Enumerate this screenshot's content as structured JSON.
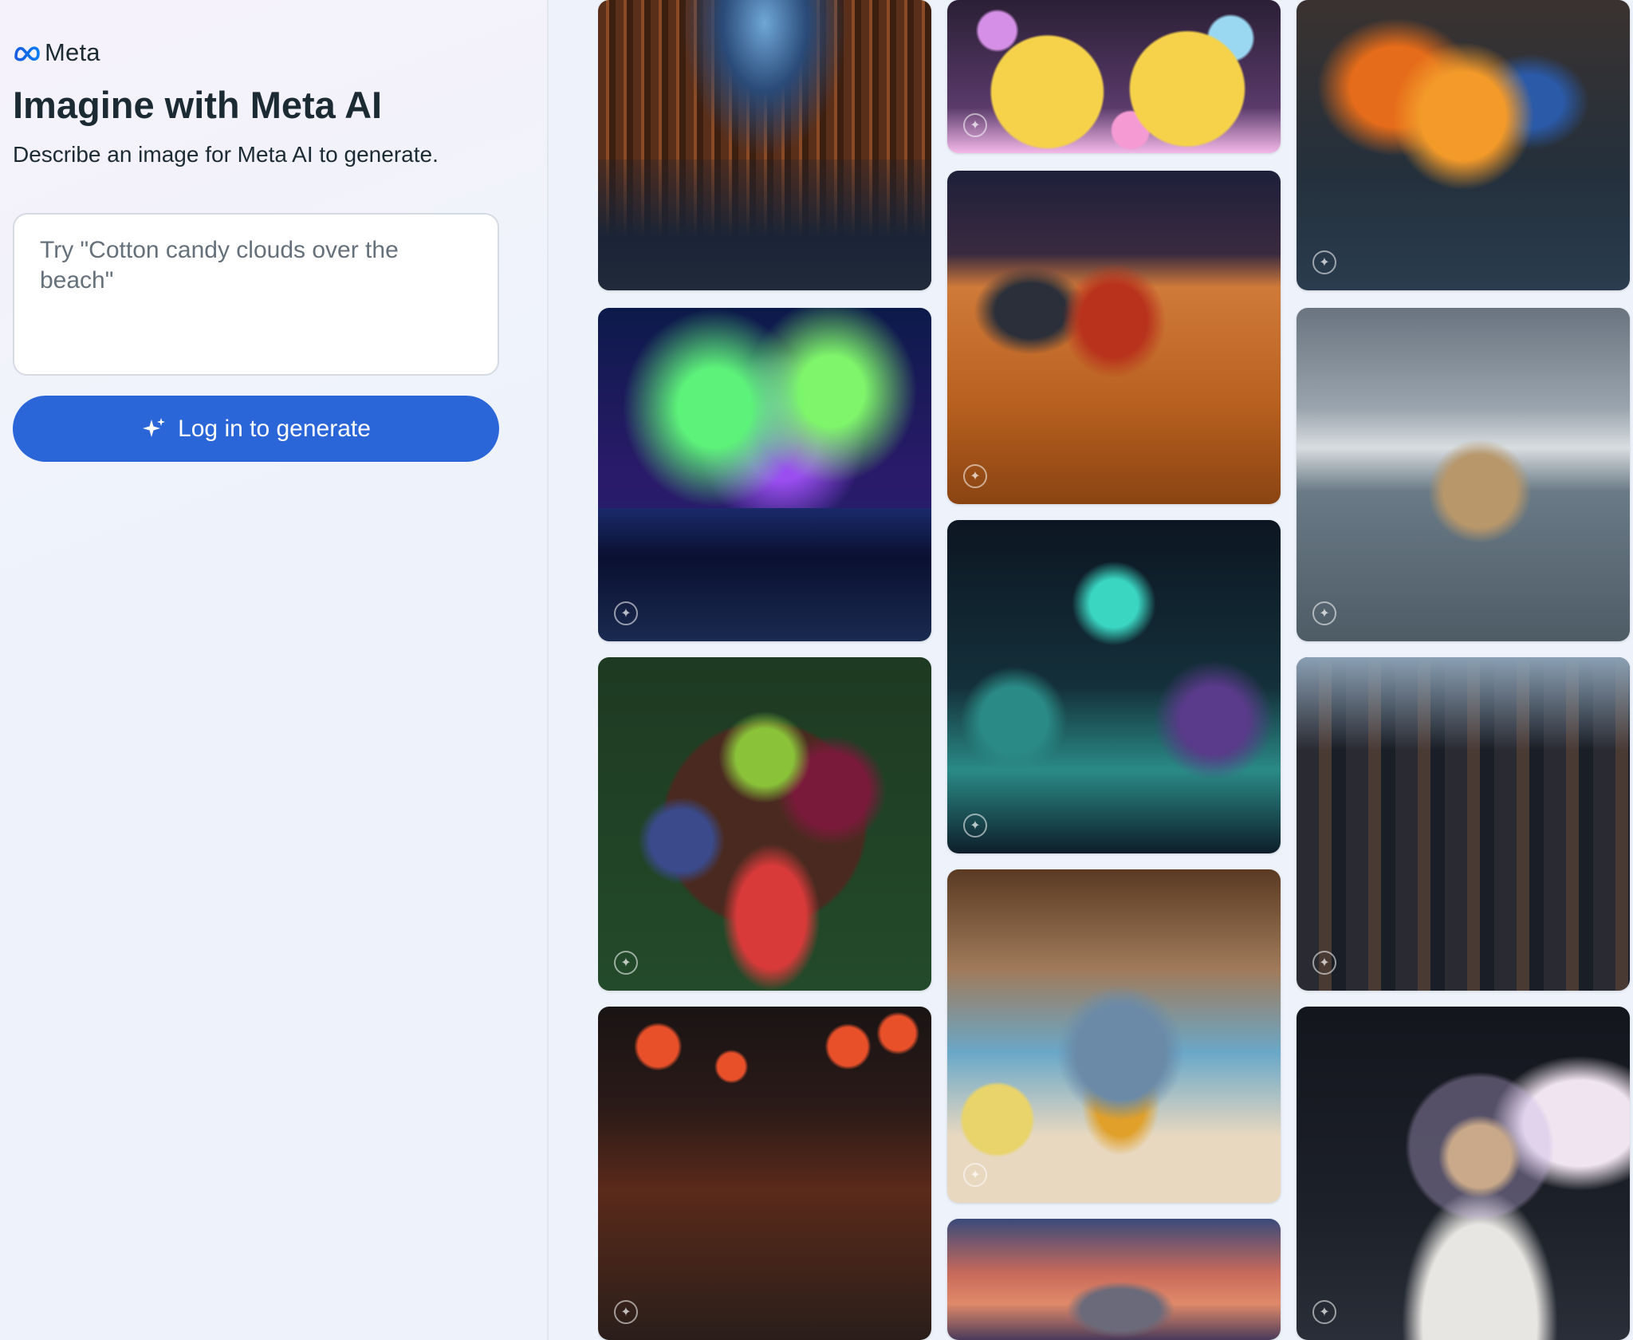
{
  "brand": {
    "logo_text": "Meta",
    "accent": "#2b66d9",
    "text_color": "#1c2b33"
  },
  "header": {
    "title": "Imagine with Meta AI",
    "subtitle": "Describe an image for Meta AI to generate."
  },
  "prompt": {
    "placeholder": "Try \"Cotton candy clouds over the beach\"",
    "value": ""
  },
  "login_button": {
    "label": "Log in to generate",
    "icon": "sparkle-icon"
  },
  "gallery": {
    "tiles": [
      {
        "name": "library-image"
      },
      {
        "name": "aurora-image"
      },
      {
        "name": "fruit-bowl-image"
      },
      {
        "name": "lantern-temple-image"
      },
      {
        "name": "rubber-ducks-image"
      },
      {
        "name": "desert-race-car-image"
      },
      {
        "name": "space-explorers-image"
      },
      {
        "name": "fluffy-bird-image"
      },
      {
        "name": "castle-sunset-image"
      },
      {
        "name": "butterfly-street-image"
      },
      {
        "name": "dog-in-sea-image"
      },
      {
        "name": "futuristic-city-image"
      },
      {
        "name": "astronaut-kitten-image"
      }
    ]
  }
}
